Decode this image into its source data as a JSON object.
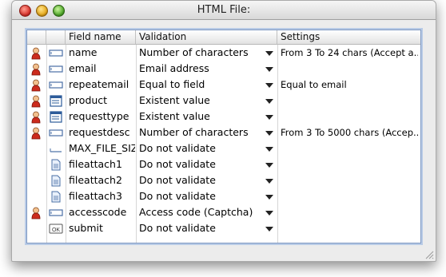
{
  "window": {
    "title": "HTML File:"
  },
  "table": {
    "columns": {
      "field_name": "Field name",
      "validation": "Validation",
      "settings": "Settings"
    },
    "rows": [
      {
        "required": true,
        "icon": "text-field-icon",
        "name": "name",
        "validation": "Number of characters",
        "settings": "From 3 To 24 chars (Accept a..."
      },
      {
        "required": true,
        "icon": "text-field-icon",
        "name": "email",
        "validation": "Email address",
        "settings": ""
      },
      {
        "required": true,
        "icon": "text-field-icon",
        "name": "repeatemail",
        "validation": "Equal to field",
        "settings": "Equal to email"
      },
      {
        "required": true,
        "icon": "list-field-icon",
        "name": "product",
        "validation": "Existent value",
        "settings": ""
      },
      {
        "required": true,
        "icon": "list-field-icon",
        "name": "requesttype",
        "validation": "Existent value",
        "settings": ""
      },
      {
        "required": true,
        "icon": "text-field-icon",
        "name": "requestdesc",
        "validation": "Number of characters",
        "settings": "From 3 To 5000 chars (Accep..."
      },
      {
        "required": false,
        "icon": "hidden-field-icon",
        "name": "MAX_FILE_SIZE",
        "validation": "Do not validate",
        "settings": ""
      },
      {
        "required": false,
        "icon": "file-icon",
        "name": "fileattach1",
        "validation": "Do not validate",
        "settings": ""
      },
      {
        "required": false,
        "icon": "file-icon",
        "name": "fileattach2",
        "validation": "Do not validate",
        "settings": ""
      },
      {
        "required": false,
        "icon": "file-icon",
        "name": "fileattach3",
        "validation": "Do not validate",
        "settings": ""
      },
      {
        "required": true,
        "icon": "text-field-icon",
        "name": "accesscode",
        "validation": "Access code (Captcha)",
        "settings": ""
      },
      {
        "required": false,
        "icon": "ok-button-icon",
        "name": "submit",
        "validation": "Do not validate",
        "settings": ""
      }
    ],
    "ok_label": "OK"
  }
}
